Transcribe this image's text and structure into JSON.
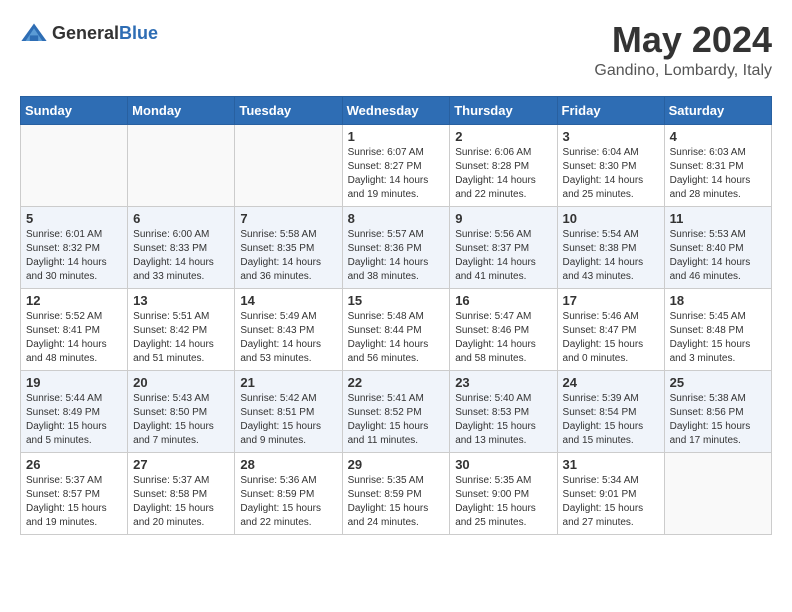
{
  "header": {
    "logo_general": "General",
    "logo_blue": "Blue",
    "month": "May 2024",
    "location": "Gandino, Lombardy, Italy"
  },
  "days_of_week": [
    "Sunday",
    "Monday",
    "Tuesday",
    "Wednesday",
    "Thursday",
    "Friday",
    "Saturday"
  ],
  "weeks": [
    [
      {
        "day": "",
        "info": ""
      },
      {
        "day": "",
        "info": ""
      },
      {
        "day": "",
        "info": ""
      },
      {
        "day": "1",
        "info": "Sunrise: 6:07 AM\nSunset: 8:27 PM\nDaylight: 14 hours\nand 19 minutes."
      },
      {
        "day": "2",
        "info": "Sunrise: 6:06 AM\nSunset: 8:28 PM\nDaylight: 14 hours\nand 22 minutes."
      },
      {
        "day": "3",
        "info": "Sunrise: 6:04 AM\nSunset: 8:30 PM\nDaylight: 14 hours\nand 25 minutes."
      },
      {
        "day": "4",
        "info": "Sunrise: 6:03 AM\nSunset: 8:31 PM\nDaylight: 14 hours\nand 28 minutes."
      }
    ],
    [
      {
        "day": "5",
        "info": "Sunrise: 6:01 AM\nSunset: 8:32 PM\nDaylight: 14 hours\nand 30 minutes."
      },
      {
        "day": "6",
        "info": "Sunrise: 6:00 AM\nSunset: 8:33 PM\nDaylight: 14 hours\nand 33 minutes."
      },
      {
        "day": "7",
        "info": "Sunrise: 5:58 AM\nSunset: 8:35 PM\nDaylight: 14 hours\nand 36 minutes."
      },
      {
        "day": "8",
        "info": "Sunrise: 5:57 AM\nSunset: 8:36 PM\nDaylight: 14 hours\nand 38 minutes."
      },
      {
        "day": "9",
        "info": "Sunrise: 5:56 AM\nSunset: 8:37 PM\nDaylight: 14 hours\nand 41 minutes."
      },
      {
        "day": "10",
        "info": "Sunrise: 5:54 AM\nSunset: 8:38 PM\nDaylight: 14 hours\nand 43 minutes."
      },
      {
        "day": "11",
        "info": "Sunrise: 5:53 AM\nSunset: 8:40 PM\nDaylight: 14 hours\nand 46 minutes."
      }
    ],
    [
      {
        "day": "12",
        "info": "Sunrise: 5:52 AM\nSunset: 8:41 PM\nDaylight: 14 hours\nand 48 minutes."
      },
      {
        "day": "13",
        "info": "Sunrise: 5:51 AM\nSunset: 8:42 PM\nDaylight: 14 hours\nand 51 minutes."
      },
      {
        "day": "14",
        "info": "Sunrise: 5:49 AM\nSunset: 8:43 PM\nDaylight: 14 hours\nand 53 minutes."
      },
      {
        "day": "15",
        "info": "Sunrise: 5:48 AM\nSunset: 8:44 PM\nDaylight: 14 hours\nand 56 minutes."
      },
      {
        "day": "16",
        "info": "Sunrise: 5:47 AM\nSunset: 8:46 PM\nDaylight: 14 hours\nand 58 minutes."
      },
      {
        "day": "17",
        "info": "Sunrise: 5:46 AM\nSunset: 8:47 PM\nDaylight: 15 hours\nand 0 minutes."
      },
      {
        "day": "18",
        "info": "Sunrise: 5:45 AM\nSunset: 8:48 PM\nDaylight: 15 hours\nand 3 minutes."
      }
    ],
    [
      {
        "day": "19",
        "info": "Sunrise: 5:44 AM\nSunset: 8:49 PM\nDaylight: 15 hours\nand 5 minutes."
      },
      {
        "day": "20",
        "info": "Sunrise: 5:43 AM\nSunset: 8:50 PM\nDaylight: 15 hours\nand 7 minutes."
      },
      {
        "day": "21",
        "info": "Sunrise: 5:42 AM\nSunset: 8:51 PM\nDaylight: 15 hours\nand 9 minutes."
      },
      {
        "day": "22",
        "info": "Sunrise: 5:41 AM\nSunset: 8:52 PM\nDaylight: 15 hours\nand 11 minutes."
      },
      {
        "day": "23",
        "info": "Sunrise: 5:40 AM\nSunset: 8:53 PM\nDaylight: 15 hours\nand 13 minutes."
      },
      {
        "day": "24",
        "info": "Sunrise: 5:39 AM\nSunset: 8:54 PM\nDaylight: 15 hours\nand 15 minutes."
      },
      {
        "day": "25",
        "info": "Sunrise: 5:38 AM\nSunset: 8:56 PM\nDaylight: 15 hours\nand 17 minutes."
      }
    ],
    [
      {
        "day": "26",
        "info": "Sunrise: 5:37 AM\nSunset: 8:57 PM\nDaylight: 15 hours\nand 19 minutes."
      },
      {
        "day": "27",
        "info": "Sunrise: 5:37 AM\nSunset: 8:58 PM\nDaylight: 15 hours\nand 20 minutes."
      },
      {
        "day": "28",
        "info": "Sunrise: 5:36 AM\nSunset: 8:59 PM\nDaylight: 15 hours\nand 22 minutes."
      },
      {
        "day": "29",
        "info": "Sunrise: 5:35 AM\nSunset: 8:59 PM\nDaylight: 15 hours\nand 24 minutes."
      },
      {
        "day": "30",
        "info": "Sunrise: 5:35 AM\nSunset: 9:00 PM\nDaylight: 15 hours\nand 25 minutes."
      },
      {
        "day": "31",
        "info": "Sunrise: 5:34 AM\nSunset: 9:01 PM\nDaylight: 15 hours\nand 27 minutes."
      },
      {
        "day": "",
        "info": ""
      }
    ]
  ]
}
